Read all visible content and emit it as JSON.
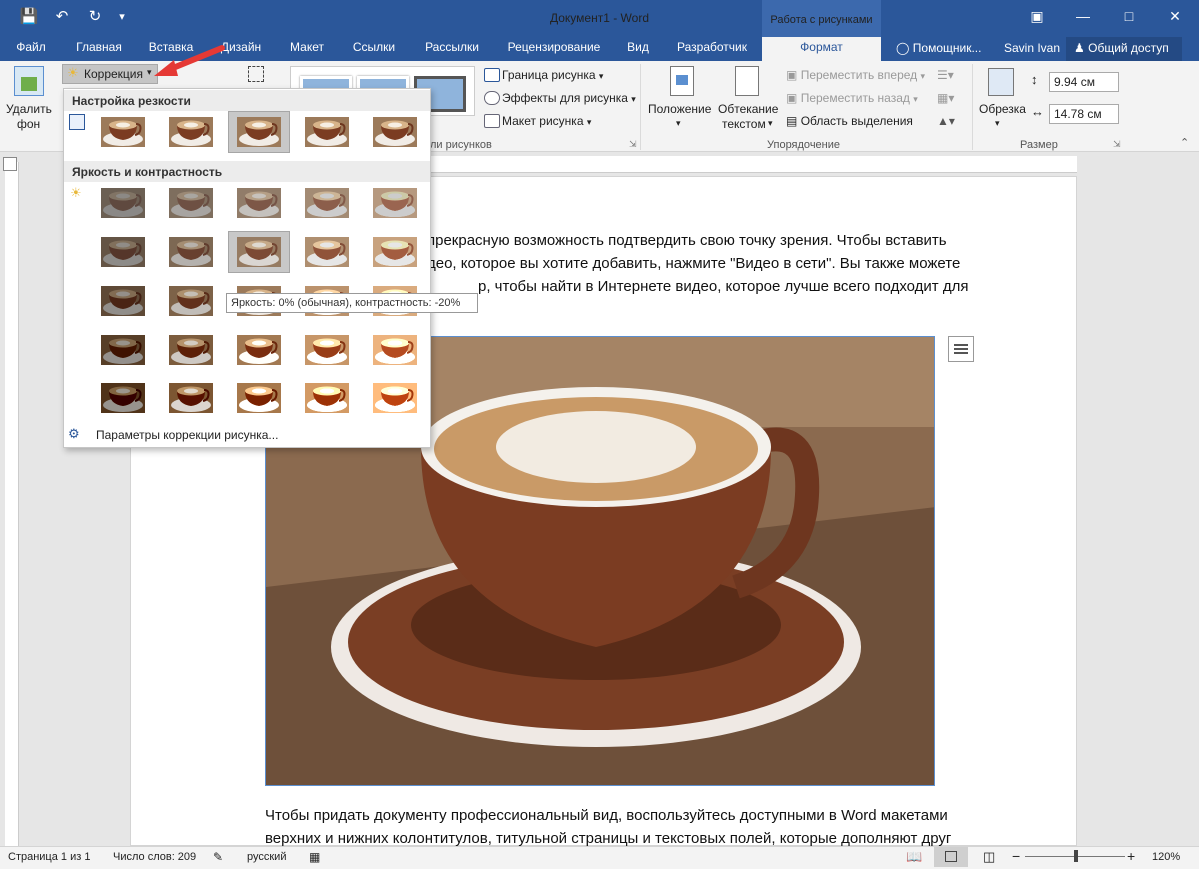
{
  "window": {
    "title": "Документ1 - Word",
    "context_tab_group": "Работа с рисунками",
    "buttons": [
      "restore-ribbon-icon",
      "minimize-icon",
      "maximize-icon",
      "close-icon"
    ]
  },
  "quick_access": [
    "save-icon",
    "undo-icon",
    "redo-icon",
    "customize-icon"
  ],
  "tabs": [
    {
      "label": "Файл"
    },
    {
      "label": "Главная"
    },
    {
      "label": "Вставка"
    },
    {
      "label": "Дизайн"
    },
    {
      "label": "Макет"
    },
    {
      "label": "Ссылки"
    },
    {
      "label": "Рассылки"
    },
    {
      "label": "Рецензирование"
    },
    {
      "label": "Вид"
    },
    {
      "label": "Разработчик"
    },
    {
      "label": "Формат",
      "active": true
    }
  ],
  "tell_me": "Помощник...",
  "user": "Savin Ivan",
  "share": "Общий доступ",
  "ribbon": {
    "remove_bg_line1": "Удалить",
    "remove_bg_line2": "фон",
    "corrections": "Коррекция",
    "styles_group": "Стили рисунков",
    "styles_group_visible": "ли рисунков",
    "border": "Граница рисунка",
    "effects": "Эффекты для рисунка",
    "layout": "Макет рисунка",
    "position": "Положение",
    "wrap_line1": "Обтекание",
    "wrap_line2": "текстом",
    "bring_forward": "Переместить вперед",
    "send_backward": "Переместить назад",
    "selection_pane": "Область выделения",
    "arrange_group": "Упорядочение",
    "crop": "Обрезка",
    "height": "9.94 см",
    "width": "14.78 см",
    "size_group": "Размер"
  },
  "gallery": {
    "section_sharpness": "Настройка резкости",
    "section_brightness": "Яркость и контрастность",
    "options": "Параметры коррекции рисунка...",
    "tooltip": "Яркость: 0% (обычная), контрастность: -20%",
    "sharpness_values": [
      -50,
      -25,
      0,
      25,
      50
    ],
    "sharpness_selected_index": 2,
    "brightness_levels": [
      -40,
      -20,
      0,
      20,
      40
    ],
    "contrast_levels": [
      -40,
      -20,
      0,
      20,
      40
    ],
    "brightness_selected": {
      "brightness": 0,
      "contrast": -20
    }
  },
  "document": {
    "para1_line1": "прекрасную возможность подтвердить свою точку зрения. Чтобы вставить",
    "para1_line2": "део, которое вы хотите добавить, нажмите \"Видео в сети\". Вы также можете",
    "para1_line3": "р, чтобы найти в Интернете видео, которое лучше всего подходит для",
    "para2_line1": "Чтобы придать документу профессиональный вид, воспользуйтесь доступными в Word макетами",
    "para2_line2": "верхних и нижних колонтитулов, титульной страницы и текстовых полей, которые дополняют друг"
  },
  "status": {
    "page": "Страница 1 из 1",
    "words": "Число слов: 209",
    "language": "русский",
    "zoom": "120%",
    "zoom_minus": "−",
    "zoom_plus": "+"
  },
  "colors": {
    "brand": "#2b579a",
    "accent_arrow": "#e53935"
  }
}
